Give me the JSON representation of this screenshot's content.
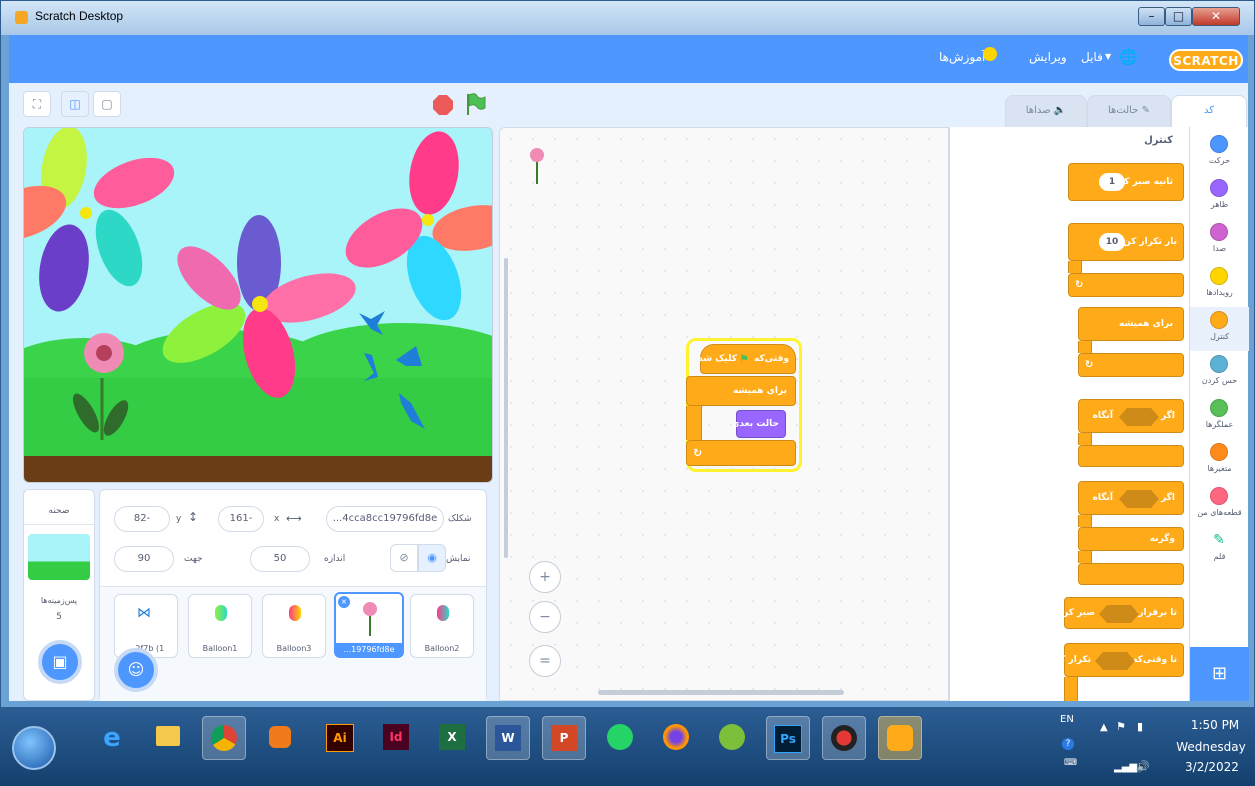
{
  "window": {
    "title": "Scratch Desktop",
    "min": "–",
    "max": "□",
    "close": "✕"
  },
  "menubar": {
    "logo": "SCRATCH",
    "globe": "🌐",
    "file": "فایل",
    "edit": "ویرایش",
    "tutorials": "آموزش‌ها"
  },
  "toolbar": {
    "fullscreen": "⛶",
    "small_stage": "◫",
    "large_stage": "▢"
  },
  "tabs": [
    {
      "label": "کد"
    },
    {
      "label": "حالت‌ها"
    },
    {
      "label": "صداها"
    }
  ],
  "sprite_info": {
    "sprite_label": "شکلک",
    "sprite_name": "...4cca8cc19796fd8e",
    "x_label": "x",
    "x_value": "161-",
    "y_label": "y",
    "y_value": "82-",
    "show_label": "نمایش",
    "size_label": "اندازه",
    "size_value": "50",
    "direction_label": "جهت",
    "direction_value": "90"
  },
  "stage_panel": {
    "header": "صحنه",
    "backdrops_label": "پس‌زمینه‌ها",
    "backdrops_count": "5"
  },
  "sprites": [
    {
      "name": "Balloon2"
    },
    {
      "name": "...19796fd8e"
    },
    {
      "name": "Balloon3"
    },
    {
      "name": "Balloon1"
    },
    {
      "name": "...2f7b (1"
    }
  ],
  "palette": {
    "heading": "کنترل",
    "wait": "ثانیه صبر کن",
    "wait_value": "1",
    "repeat": "بار تکرار کن",
    "repeat_value": "10",
    "forever": "برای همیشه",
    "if_then_1": "اگر",
    "then_word": "آنگاه",
    "if_then_2": "اگر",
    "else_word": "وگرنه",
    "wait_until": "صبر کن",
    "wait_until_prefix": "تا برقراری",
    "repeat_until": "تکرار کن",
    "repeat_until_prefix": "تا وقتی‌که",
    "arrow": "↻"
  },
  "script": {
    "hat": "وقتی‌که",
    "hat_suffix": "کلیک شد",
    "forever": "برای همیشه",
    "next_costume": "حالت بعدی",
    "arrow": "↻"
  },
  "categories": [
    {
      "label": "حرکت",
      "color": "#4c97ff"
    },
    {
      "label": "ظاهر",
      "color": "#9966ff"
    },
    {
      "label": "صدا",
      "color": "#cf63cf"
    },
    {
      "label": "رویدادها",
      "color": "#ffd500"
    },
    {
      "label": "کنترل",
      "color": "#ffab19"
    },
    {
      "label": "حس کردن",
      "color": "#5cb1d6"
    },
    {
      "label": "عملگرها",
      "color": "#59c059"
    },
    {
      "label": "متغیرها",
      "color": "#ff8c1a"
    },
    {
      "label": "قطعه‌های من",
      "color": "#ff6680"
    },
    {
      "label": "قلم",
      "color": "#0fbd8c"
    }
  ],
  "zoom": {
    "in": "+",
    "out": "−",
    "reset": "="
  },
  "taskbar": {
    "lang": "EN",
    "time": "1:50 PM",
    "day": "Wednesday",
    "date": "3/2/2022"
  },
  "taskbar_apps": {
    "ai": "Ai",
    "id": "Id",
    "excel": "X",
    "word": "W",
    "ppt": "P",
    "ps": "Ps"
  }
}
